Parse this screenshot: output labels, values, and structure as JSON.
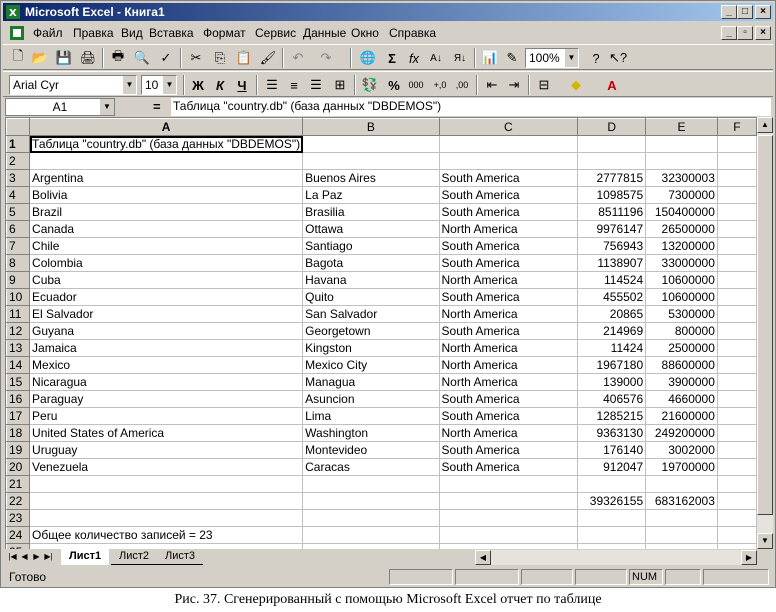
{
  "window": {
    "title": "Microsoft Excel - Книга1"
  },
  "menu": [
    "Файл",
    "Правка",
    "Вид",
    "Вставка",
    "Формат",
    "Сервис",
    "Данные",
    "Окно",
    "Справка"
  ],
  "toolbar": {
    "zoom": "100%",
    "font_name": "Arial Cyr",
    "font_size": "10",
    "bold": "Ж",
    "italic": "К",
    "underline": "Ч"
  },
  "formula_bar": {
    "name_box": "A1",
    "equals": "=",
    "formula": "Таблица \"country.db\" (база данных \"DBDEMOS\")"
  },
  "columns": [
    "A",
    "B",
    "C",
    "D",
    "E",
    "F"
  ],
  "rows": [
    [
      "Таблица \"country.db\" (база данных \"DBDEMOS\")",
      "",
      "",
      "",
      "",
      ""
    ],
    [
      "",
      "",
      "",
      "",
      "",
      ""
    ],
    [
      "Argentina",
      "Buenos Aires",
      "South America",
      "2777815",
      "32300003",
      ""
    ],
    [
      "Bolivia",
      "La Paz",
      "South America",
      "1098575",
      "7300000",
      ""
    ],
    [
      "Brazil",
      "Brasilia",
      "South America",
      "8511196",
      "150400000",
      ""
    ],
    [
      "Canada",
      "Ottawa",
      "North America",
      "9976147",
      "26500000",
      ""
    ],
    [
      "Chile",
      "Santiago",
      "South America",
      "756943",
      "13200000",
      ""
    ],
    [
      "Colombia",
      "Bagota",
      "South America",
      "1138907",
      "33000000",
      ""
    ],
    [
      "Cuba",
      "Havana",
      "North America",
      "114524",
      "10600000",
      ""
    ],
    [
      "Ecuador",
      "Quito",
      "South America",
      "455502",
      "10600000",
      ""
    ],
    [
      "El Salvador",
      "San Salvador",
      "North America",
      "20865",
      "5300000",
      ""
    ],
    [
      "Guyana",
      "Georgetown",
      "South America",
      "214969",
      "800000",
      ""
    ],
    [
      "Jamaica",
      "Kingston",
      "North America",
      "11424",
      "2500000",
      ""
    ],
    [
      "Mexico",
      "Mexico City",
      "North America",
      "1967180",
      "88600000",
      ""
    ],
    [
      "Nicaragua",
      "Managua",
      "North America",
      "139000",
      "3900000",
      ""
    ],
    [
      "Paraguay",
      "Asuncion",
      "South America",
      "406576",
      "4660000",
      ""
    ],
    [
      "Peru",
      "Lima",
      "South America",
      "1285215",
      "21600000",
      ""
    ],
    [
      "United States of America",
      "Washington",
      "North America",
      "9363130",
      "249200000",
      ""
    ],
    [
      "Uruguay",
      "Montevideo",
      "South America",
      "176140",
      "3002000",
      ""
    ],
    [
      "Venezuela",
      "Caracas",
      "South America",
      "912047",
      "19700000",
      ""
    ],
    [
      "",
      "",
      "",
      "",
      "",
      ""
    ],
    [
      "",
      "",
      "",
      "39326155",
      "683162003",
      ""
    ],
    [
      "",
      "",
      "",
      "",
      "",
      ""
    ],
    [
      "Общее количество записей = 23",
      "",
      "",
      "",
      "",
      ""
    ],
    [
      "",
      "",
      "",
      "",
      "",
      ""
    ]
  ],
  "sheet_tabs": [
    "Лист1",
    "Лист2",
    "Лист3"
  ],
  "status": {
    "text": "Готово",
    "num": "NUM"
  },
  "caption": "Рис. 37. Сгенерированный с помощью Microsoft Excel отчет по таблице"
}
